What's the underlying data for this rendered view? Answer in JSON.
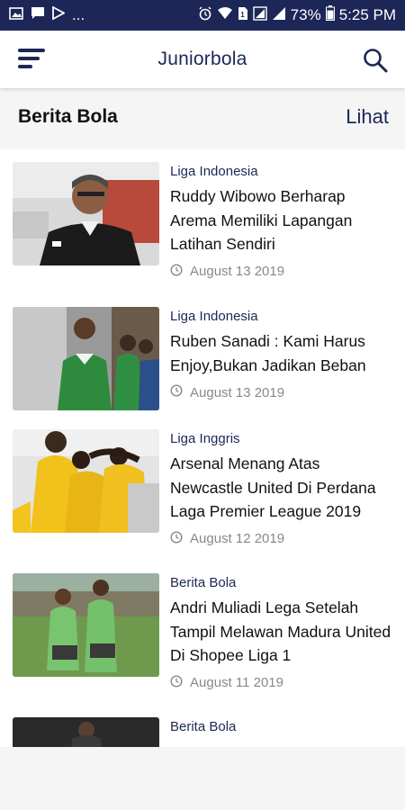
{
  "status_bar": {
    "dots": "...",
    "battery_percent": "73%",
    "time": "5:25 PM"
  },
  "app_bar": {
    "title": "Juniorbola",
    "menu_icon": "menu-icon",
    "search_icon": "search-icon"
  },
  "section": {
    "title": "Berita Bola",
    "link": "Lihat"
  },
  "news": [
    {
      "category": "Liga Indonesia",
      "headline": "Ruddy Wibowo Berharap Arema Memiliki Lapangan Latihan Sendiri",
      "date": "August 13 2019"
    },
    {
      "category": "Liga Indonesia",
      "headline": "Ruben Sanadi : Kami Harus Enjoy,Bukan Jadikan Beban",
      "date": "August 13 2019"
    },
    {
      "category": "Liga Inggris",
      "headline": "Arsenal Menang Atas Newcastle United Di Perdana Laga Premier League 2019",
      "date": "August 12 2019"
    },
    {
      "category": "Berita Bola",
      "headline": "Andri Muliadi Lega Setelah Tampil Melawan Madura United Di Shopee Liga 1",
      "date": "August 11 2019"
    },
    {
      "category": "Berita Bola"
    }
  ],
  "colors": {
    "primary": "#1c2758",
    "status_bar": "#1c2758",
    "date_text": "#888888"
  }
}
